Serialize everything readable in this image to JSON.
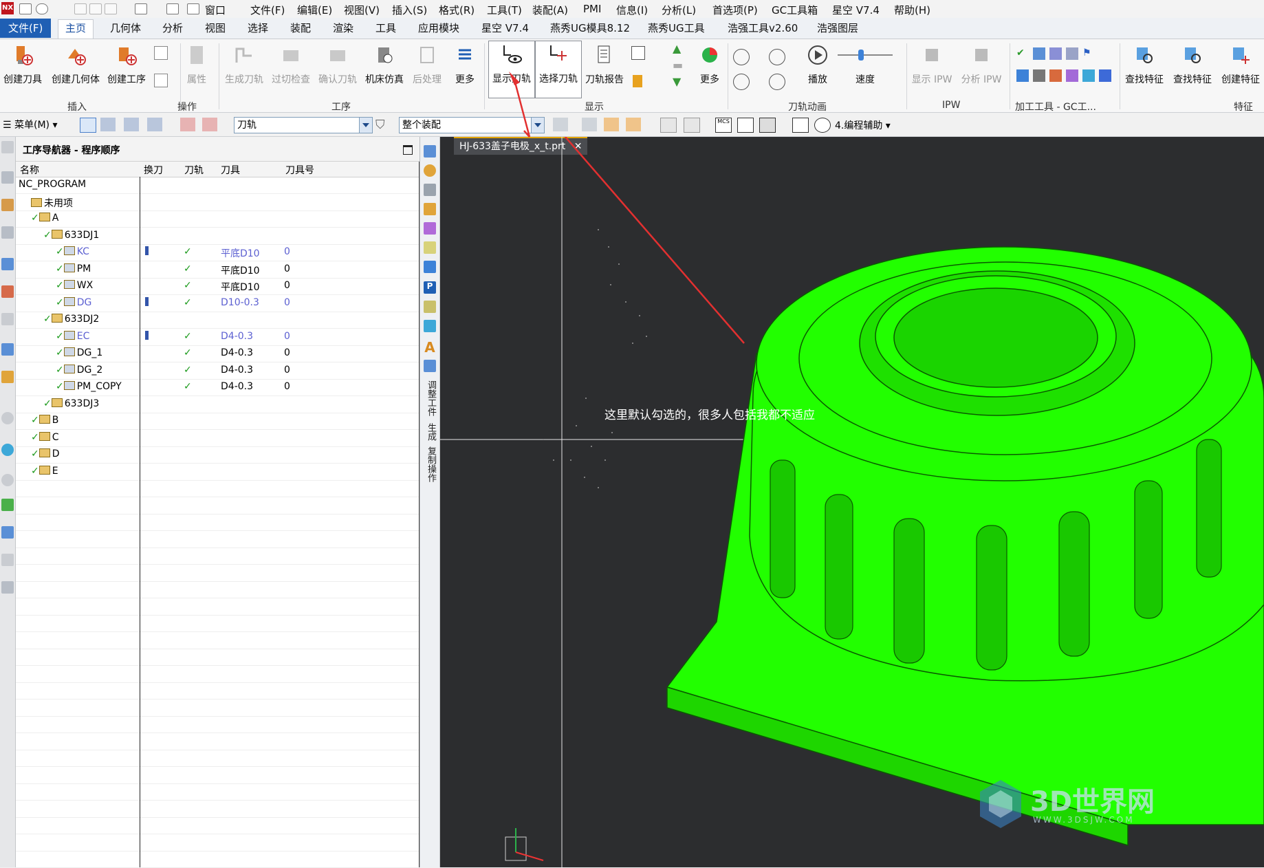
{
  "quickbar": {
    "menus": [
      "窗口",
      "文件(F)",
      "编辑(E)",
      "视图(V)",
      "插入(S)",
      "格式(R)",
      "工具(T)",
      "装配(A)",
      "PMI",
      "信息(I)",
      "分析(L)",
      "首选项(P)",
      "GC工具箱",
      "星空 V7.4",
      "帮助(H)"
    ]
  },
  "tabs": [
    "文件(F)",
    "主页",
    "几何体",
    "分析",
    "视图",
    "选择",
    "装配",
    "渲染",
    "工具",
    "应用模块",
    "星空 V7.4",
    "燕秀UG模具8.12",
    "燕秀UG工具",
    "浩强工具v2.60",
    "浩强图层"
  ],
  "ribbon": {
    "buttons": {
      "create_tool": "创建刀具",
      "create_geometry": "创建几何体",
      "create_operation": "创建工序",
      "properties": "属性",
      "generate_toolpath": "生成刀轨",
      "gouge_check": "过切检查",
      "verify_toolpath": "确认刀轨",
      "machine_sim": "机床仿真",
      "postprocess": "后处理",
      "more1": "更多",
      "show_toolpath": "显示刀轨",
      "select_toolpath": "选择刀轨",
      "toolpath_report": "刀轨报告",
      "more2": "更多",
      "play": "播放",
      "speed": "速度",
      "show_ipw": "显示 IPW",
      "analyze_ipw": "分析 IPW",
      "find_feature1": "查找特征",
      "find_feature2": "查找特征",
      "create_feature": "创建特征"
    },
    "groups": {
      "insert": "插入",
      "operations": "操作",
      "procedure": "工序",
      "display": "显示",
      "toolpath_anim": "刀轨动画",
      "ipw": "IPW",
      "machining_tools": "加工工具 - GC工...",
      "features": "特征"
    }
  },
  "toolbar2": {
    "menu": "菜单(M)",
    "filter_value": "刀轨",
    "scope_value": "整个装配",
    "assist": "4.编程辅助"
  },
  "navigator": {
    "title": "工序导航器 - 程序顺序",
    "columns": [
      "名称",
      "换刀",
      "刀轨",
      "刀具",
      "刀具号"
    ],
    "rows": [
      {
        "name": "NC_PROGRAM",
        "tool": "",
        "num": ""
      },
      {
        "name": "未用项",
        "tool": "",
        "num": ""
      },
      {
        "name": "A",
        "tool": "",
        "num": ""
      },
      {
        "name": "633DJ1",
        "tool": "",
        "num": ""
      },
      {
        "name": "KC",
        "tool": "平底D10",
        "num": "0"
      },
      {
        "name": "PM",
        "tool": "平底D10",
        "num": "0"
      },
      {
        "name": "WX",
        "tool": "平底D10",
        "num": "0"
      },
      {
        "name": "DG",
        "tool": "D10-0.3",
        "num": "0"
      },
      {
        "name": "633DJ2",
        "tool": "",
        "num": ""
      },
      {
        "name": "EC",
        "tool": "D4-0.3",
        "num": "0"
      },
      {
        "name": "DG_1",
        "tool": "D4-0.3",
        "num": "0"
      },
      {
        "name": "DG_2",
        "tool": "D4-0.3",
        "num": "0"
      },
      {
        "name": "PM_COPY",
        "tool": "D4-0.3",
        "num": "0"
      },
      {
        "name": "633DJ3",
        "tool": "",
        "num": ""
      },
      {
        "name": "B",
        "tool": "",
        "num": ""
      },
      {
        "name": "C",
        "tool": "",
        "num": ""
      },
      {
        "name": "D",
        "tool": "",
        "num": ""
      },
      {
        "name": "E",
        "tool": "",
        "num": ""
      }
    ]
  },
  "vstrip": {
    "labels": [
      "调整工件",
      "生成",
      "复制操作"
    ]
  },
  "viewport": {
    "tab_title": "HJ-633盖子电极_x_t.prt",
    "annotation": "这里默认勾选的，很多人包括我都不适应",
    "watermark_main": "3D世界网",
    "watermark_sub": "WWW.3DSJW.COM"
  },
  "colors": {
    "model": "#22ff00",
    "viewport_bg": "#2c2d2f",
    "accent": "#1f5fb4",
    "arrow": "#e23030"
  }
}
